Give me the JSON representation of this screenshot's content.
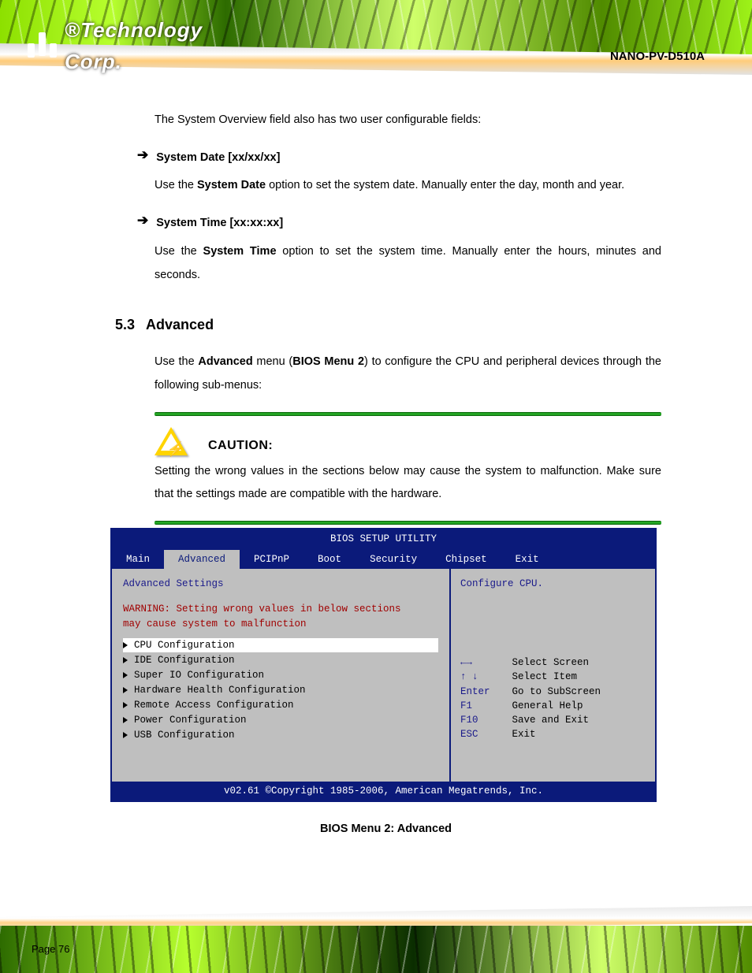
{
  "header": {
    "logo_text": "®Technology Corp.",
    "product_title": "NANO-PV-D510A"
  },
  "body": {
    "intro": "The System Overview field also has two user configurable fields:",
    "date": {
      "bullet_label": "System Date [xx/xx/xx]",
      "para_pre": "Use the ",
      "para_bold": "System Date",
      "para_post": " option to set the system date. Manually enter the day, month and year."
    },
    "time": {
      "bullet_label": "System Time [xx:xx:xx]",
      "para_pre": "Use the ",
      "para_bold": "System Time",
      "para_post": " option to set the system time. Manually enter the hours, minutes and seconds."
    }
  },
  "section": {
    "number": "5.3",
    "title": "Advanced",
    "para_pre": "Use the ",
    "para_bold": "Advanced",
    "para_mid": " menu (",
    "para_ref": "BIOS Menu 2",
    "para_post": ") to configure the CPU and peripheral devices through the following sub-menus:"
  },
  "caution": {
    "title": "CAUTION:",
    "text": "Setting the wrong values in the sections below may cause the system to malfunction. Make sure that the settings made are compatible with the hardware."
  },
  "bios": {
    "title": "BIOS SETUP UTILITY",
    "tabs": [
      "Main",
      "Advanced",
      "PCIPnP",
      "Boot",
      "Security",
      "Chipset",
      "Exit"
    ],
    "active_tab": 1,
    "left_title": "Advanced Settings",
    "warning_l1": "WARNING: Setting wrong values in below sections",
    "warning_l2": "         may cause system to malfunction",
    "items": [
      "CPU Configuration",
      "IDE Configuration",
      "Super IO Configuration",
      "Hardware Health Configuration",
      "Remote Access Configuration",
      "Power Configuration",
      "USB Configuration"
    ],
    "selected_item": 0,
    "hint_top": "Configure CPU.",
    "keys": [
      {
        "k": "←→",
        "d": "Select Screen"
      },
      {
        "k": "↑ ↓",
        "d": "Select Item"
      },
      {
        "k": "Enter",
        "d": "Go to SubScreen"
      },
      {
        "k": "F1",
        "d": "General Help"
      },
      {
        "k": "F10",
        "d": "Save and Exit"
      },
      {
        "k": "ESC",
        "d": "Exit"
      }
    ],
    "footer": "v02.61 ©Copyright 1985-2006, American Megatrends, Inc.",
    "caption": "BIOS Menu 2: Advanced"
  },
  "footer": {
    "page_label": "Page 76"
  }
}
